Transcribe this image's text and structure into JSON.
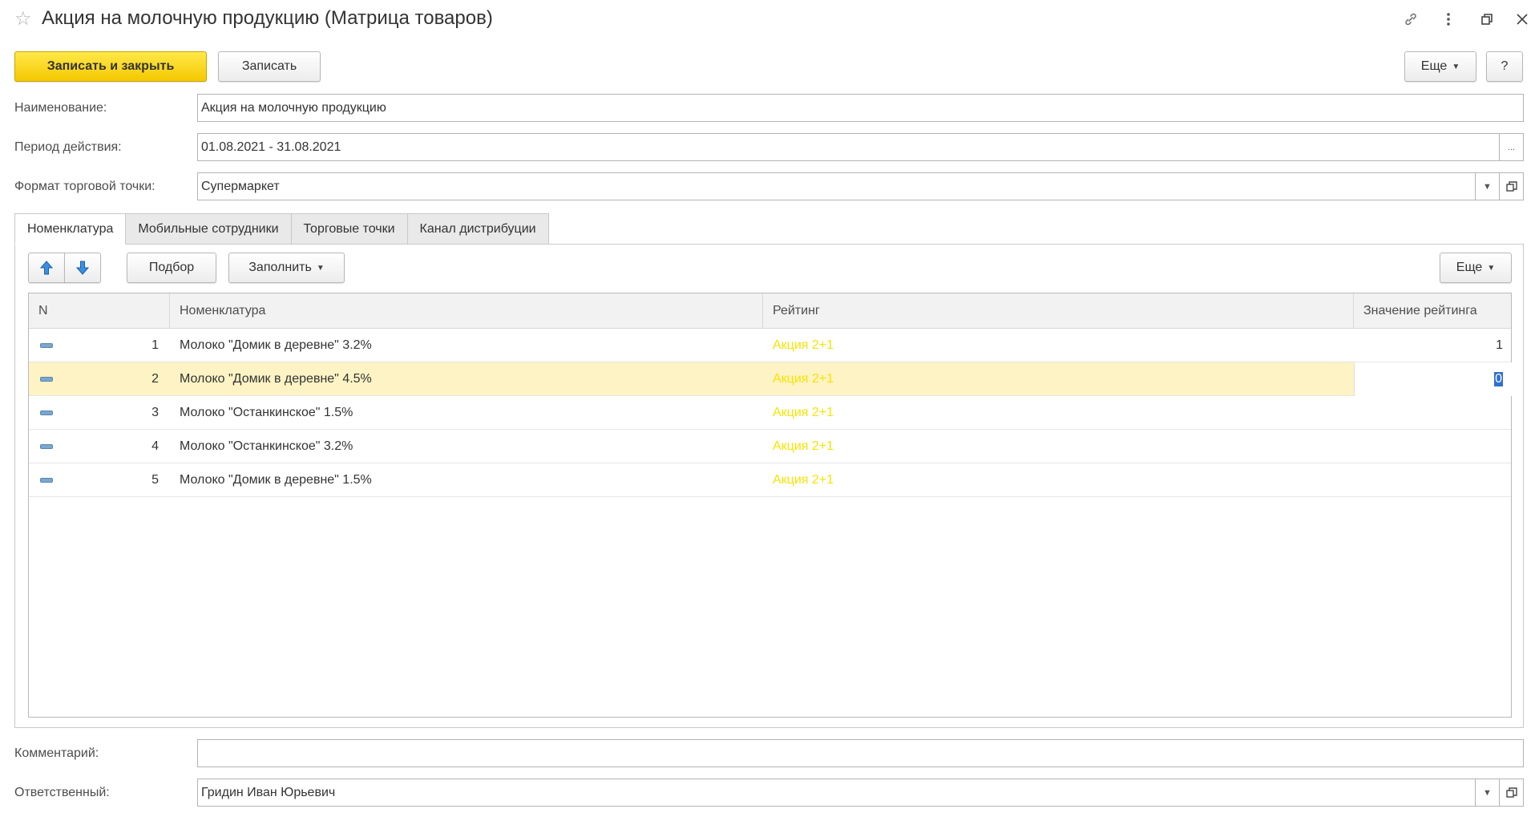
{
  "window": {
    "title": "Акция на молочную продукцию (Матрица товаров)",
    "star_icon": "star-icon",
    "link_icon": "link-icon",
    "menu_icon": "kebab-menu-icon",
    "restore_icon": "restore-window-icon",
    "close_icon": "close-icon"
  },
  "toolbar": {
    "save_close_label": "Записать и закрыть",
    "save_label": "Записать",
    "more_label": "Еще",
    "help_label": "?"
  },
  "form": {
    "name_label": "Наименование:",
    "name_value": "Акция на молочную продукцию",
    "period_label": "Период действия:",
    "period_value": "01.08.2021 - 31.08.2021",
    "period_button": "...",
    "format_label": "Формат торговой точки:",
    "format_value": "Супермаркет",
    "comment_label": "Комментарий:",
    "comment_value": "",
    "responsible_label": "Ответственный:",
    "responsible_value": "Гридин Иван Юрьевич"
  },
  "tabs": [
    {
      "label": "Номенклатура",
      "active": true
    },
    {
      "label": "Мобильные сотрудники",
      "active": false
    },
    {
      "label": "Торговые точки",
      "active": false
    },
    {
      "label": "Канал дистрибуции",
      "active": false
    }
  ],
  "table_toolbar": {
    "up_icon": "arrow-up-icon",
    "down_icon": "arrow-down-icon",
    "pick_label": "Подбор",
    "fill_label": "Заполнить",
    "more_label": "Еще"
  },
  "table": {
    "columns": [
      "N",
      "Номенклатура",
      "Рейтинг",
      "Значение рейтинга"
    ],
    "rows": [
      {
        "n": "1",
        "item": "Молоко \"Домик в деревне\" 3.2%",
        "rating": "Акция 2+1",
        "value": "1",
        "selected": false
      },
      {
        "n": "2",
        "item": "Молоко \"Домик в деревне\" 4.5%",
        "rating": "Акция 2+1",
        "value": "0",
        "selected": true
      },
      {
        "n": "3",
        "item": "Молоко \"Останкинское\" 1.5%",
        "rating": "Акция 2+1",
        "value": "",
        "selected": false
      },
      {
        "n": "4",
        "item": "Молоко \"Останкинское\" 3.2%",
        "rating": "Акция 2+1",
        "value": "",
        "selected": false
      },
      {
        "n": "5",
        "item": "Молоко \"Домик в деревне\" 1.5%",
        "rating": "Акция 2+1",
        "value": "",
        "selected": false
      }
    ]
  },
  "colors": {
    "primary_button": "#f5c800",
    "rating_text": "#f7e400",
    "selected_row": "#fdf3c4"
  }
}
